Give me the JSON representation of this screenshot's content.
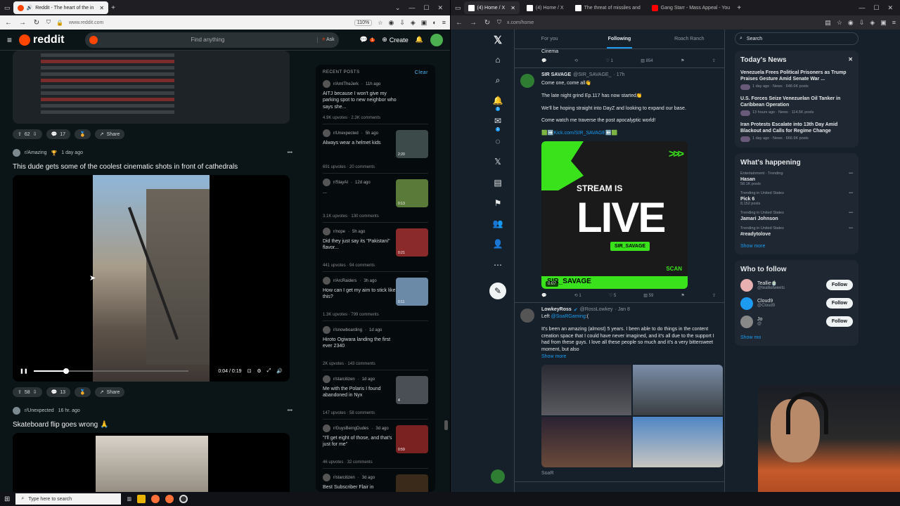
{
  "left_browser": {
    "tabs": [
      {
        "title": "Reddit - The heart of the in",
        "active": true
      }
    ],
    "url": "www.reddit.com",
    "zoom": "110%"
  },
  "reddit": {
    "search_placeholder": "Find anything",
    "ask_label": "Ask",
    "create_label": "Create",
    "chat_badge": "1",
    "post1_actions": {
      "votes": "62",
      "comments": "17",
      "share": "Share"
    },
    "post2": {
      "subreddit": "r/Amazing",
      "time": "1 day ago",
      "title": "This dude gets some of the coolest cinematic shots in front of cathedrals",
      "video_time": "0:04 / 0:19",
      "progress": 0.21,
      "votes": "58",
      "comments": "13",
      "share": "Share"
    },
    "post3": {
      "subreddit": "r/Unexpected",
      "time": "16 hr. ago",
      "title": "Skateboard flip goes wrong 🙏"
    },
    "recent": {
      "heading": "RECENT POSTS",
      "clear": "Clear",
      "items": [
        {
          "sub": "r/AmITheJerk",
          "time": "11h ago",
          "title": "AITJ because I won't give my parking spot to new neighbor who says she...",
          "stats": "4.9K upvotes · 2.3K comments",
          "thumb": "",
          "color": "#222"
        },
        {
          "sub": "r/Unexpected",
          "time": "5h ago",
          "title": "Always wear a helmet kids",
          "stats": "691 upvotes · 20 comments",
          "thumb": "2:20",
          "color": "#3c4a4a"
        },
        {
          "sub": "r/SlayAI",
          "time": "12d ago",
          "title": "...",
          "stats": "3.1K upvotes · 130 comments",
          "thumb": "0:13",
          "color": "#5a7a3a"
        },
        {
          "sub": "r/nope",
          "time": "5h ago",
          "title": "Did they just say its \"Pakistani\" flavor...",
          "stats": "441 upvotes · 94 comments",
          "thumb": "0:21",
          "color": "#8a2a2a"
        },
        {
          "sub": "r/ArcRaiders",
          "time": "3h ago",
          "title": "How can I get my aim to stick like this?",
          "stats": "1.3K upvotes · 799 comments",
          "thumb": "0:11",
          "color": "#6a8aa8"
        },
        {
          "sub": "r/snowboarding",
          "time": "1d ago",
          "title": "Hiroto Ogiwara landing the first ever 2340",
          "stats": "2K upvotes · 143 comments",
          "thumb": "",
          "color": "#222"
        },
        {
          "sub": "r/starcitizen",
          "time": "1d ago",
          "title": "Me with the Polaris I found abandoned in Nyx",
          "stats": "147 upvotes · 58 comments",
          "thumb": "4",
          "color": "#4a4f55"
        },
        {
          "sub": "r/GuysBeingDudes",
          "time": "3d ago",
          "title": "\"I'll get eight of those, and that's just for me\"",
          "stats": "46 upvotes · 32 comments",
          "thumb": "0:59",
          "color": "#7a2222"
        },
        {
          "sub": "r/starcitizen",
          "time": "3d ago",
          "title": "Best Subscriber Flair in",
          "stats": "",
          "thumb": "",
          "color": "#3a2a1a"
        }
      ]
    }
  },
  "right_browser": {
    "tabs": [
      {
        "title": "(4) Home / X",
        "active": true
      },
      {
        "title": "(4) Home / X",
        "active": false
      },
      {
        "title": "The threat of missiles and",
        "active": false
      },
      {
        "title": "Gang Starr - Mass Appeal - You",
        "active": false
      }
    ],
    "url": "x.com/home"
  },
  "x": {
    "tabs": [
      "For you",
      "Following",
      "Roach Ranch"
    ],
    "badges": {
      "notifications": "1",
      "messages": "1"
    },
    "prev_tweet": {
      "text": "Cinema",
      "likes": "1",
      "views": "854"
    },
    "tweet1": {
      "name": "SIR SAVAGE",
      "handle": "@SIR_SAVAGE_",
      "time": "· 17h",
      "line1": "Come one, come all👋",
      "line2": "The late night grind Ep.117 has now started👏",
      "line3": "We'll be hoping straight into DayZ and looking to expand our base.",
      "line4": "Come watch me traverse the post apocalyptic world!",
      "link": "🟩➡️Kick.com/SIR_SAVAGE⬅️🟩",
      "card_stream": "STREAM IS",
      "card_live": "LIVE",
      "card_handle": "SIR_SAVAGE",
      "card_bottom": "SIR_SAVAGE",
      "card_scan": "SCAN",
      "video_time": "0:07",
      "retweets": "1",
      "likes": "5",
      "views": "59"
    },
    "tweet2": {
      "name": "LowkeyRoss",
      "handle": "@RossLowkey",
      "time": "· Jan 8",
      "left_text": "Left",
      "left_link": "@SoaRGaming",
      "left_suffix": ":(",
      "body": "It's been an amazing (almost) 5 years. I been able to do things in the content creation space that I could have never imagined, and it's all due to the support I had from these guys. I love all these people so much and it's a very bittersweet moment, but also",
      "show_more": "Show more",
      "footer": "SoaR"
    },
    "search_placeholder": "Search",
    "news": {
      "heading": "Today's News",
      "items": [
        {
          "title": "Venezuela Frees Political Prisoners as Trump Praises Gesture Amid Senate War ...",
          "meta": "1 day ago · News · 648.6K posts"
        },
        {
          "title": "U.S. Forces Seize Venezuelan Oil Tanker in Caribbean Operation",
          "meta": "13 hours ago · News · 114.5K posts"
        },
        {
          "title": "Iran Protests Escalate into 13th Day Amid Blackout and Calls for Regime Change",
          "meta": "1 day ago · News · 666.9K posts"
        }
      ]
    },
    "happening": {
      "heading": "What's happening",
      "items": [
        {
          "cat": "Entertainment · Trending",
          "name": "Hasan",
          "posts": "58.1K posts"
        },
        {
          "cat": "Trending in United States",
          "name": "Pick 6",
          "posts": "8,152 posts"
        },
        {
          "cat": "Trending in United States",
          "name": "Jamari Johnson",
          "posts": ""
        },
        {
          "cat": "Trending in United States",
          "name": "#readytolove",
          "posts": ""
        }
      ],
      "show_more": "Show more"
    },
    "who_to_follow": {
      "heading": "Who to follow",
      "items": [
        {
          "name": "Teallie🍵",
          "handle": "@teallietweets",
          "btn": "Follow",
          "color": "#e8b0b0"
        },
        {
          "name": "Cloud9",
          "handle": "@Cloud9",
          "btn": "Follow",
          "color": "#1d9bf0"
        },
        {
          "name": "Jo",
          "handle": "@",
          "btn": "Follow",
          "color": "#888"
        }
      ],
      "show_more": "Show mo"
    }
  },
  "taskbar": {
    "search_placeholder": "Type here to search"
  }
}
